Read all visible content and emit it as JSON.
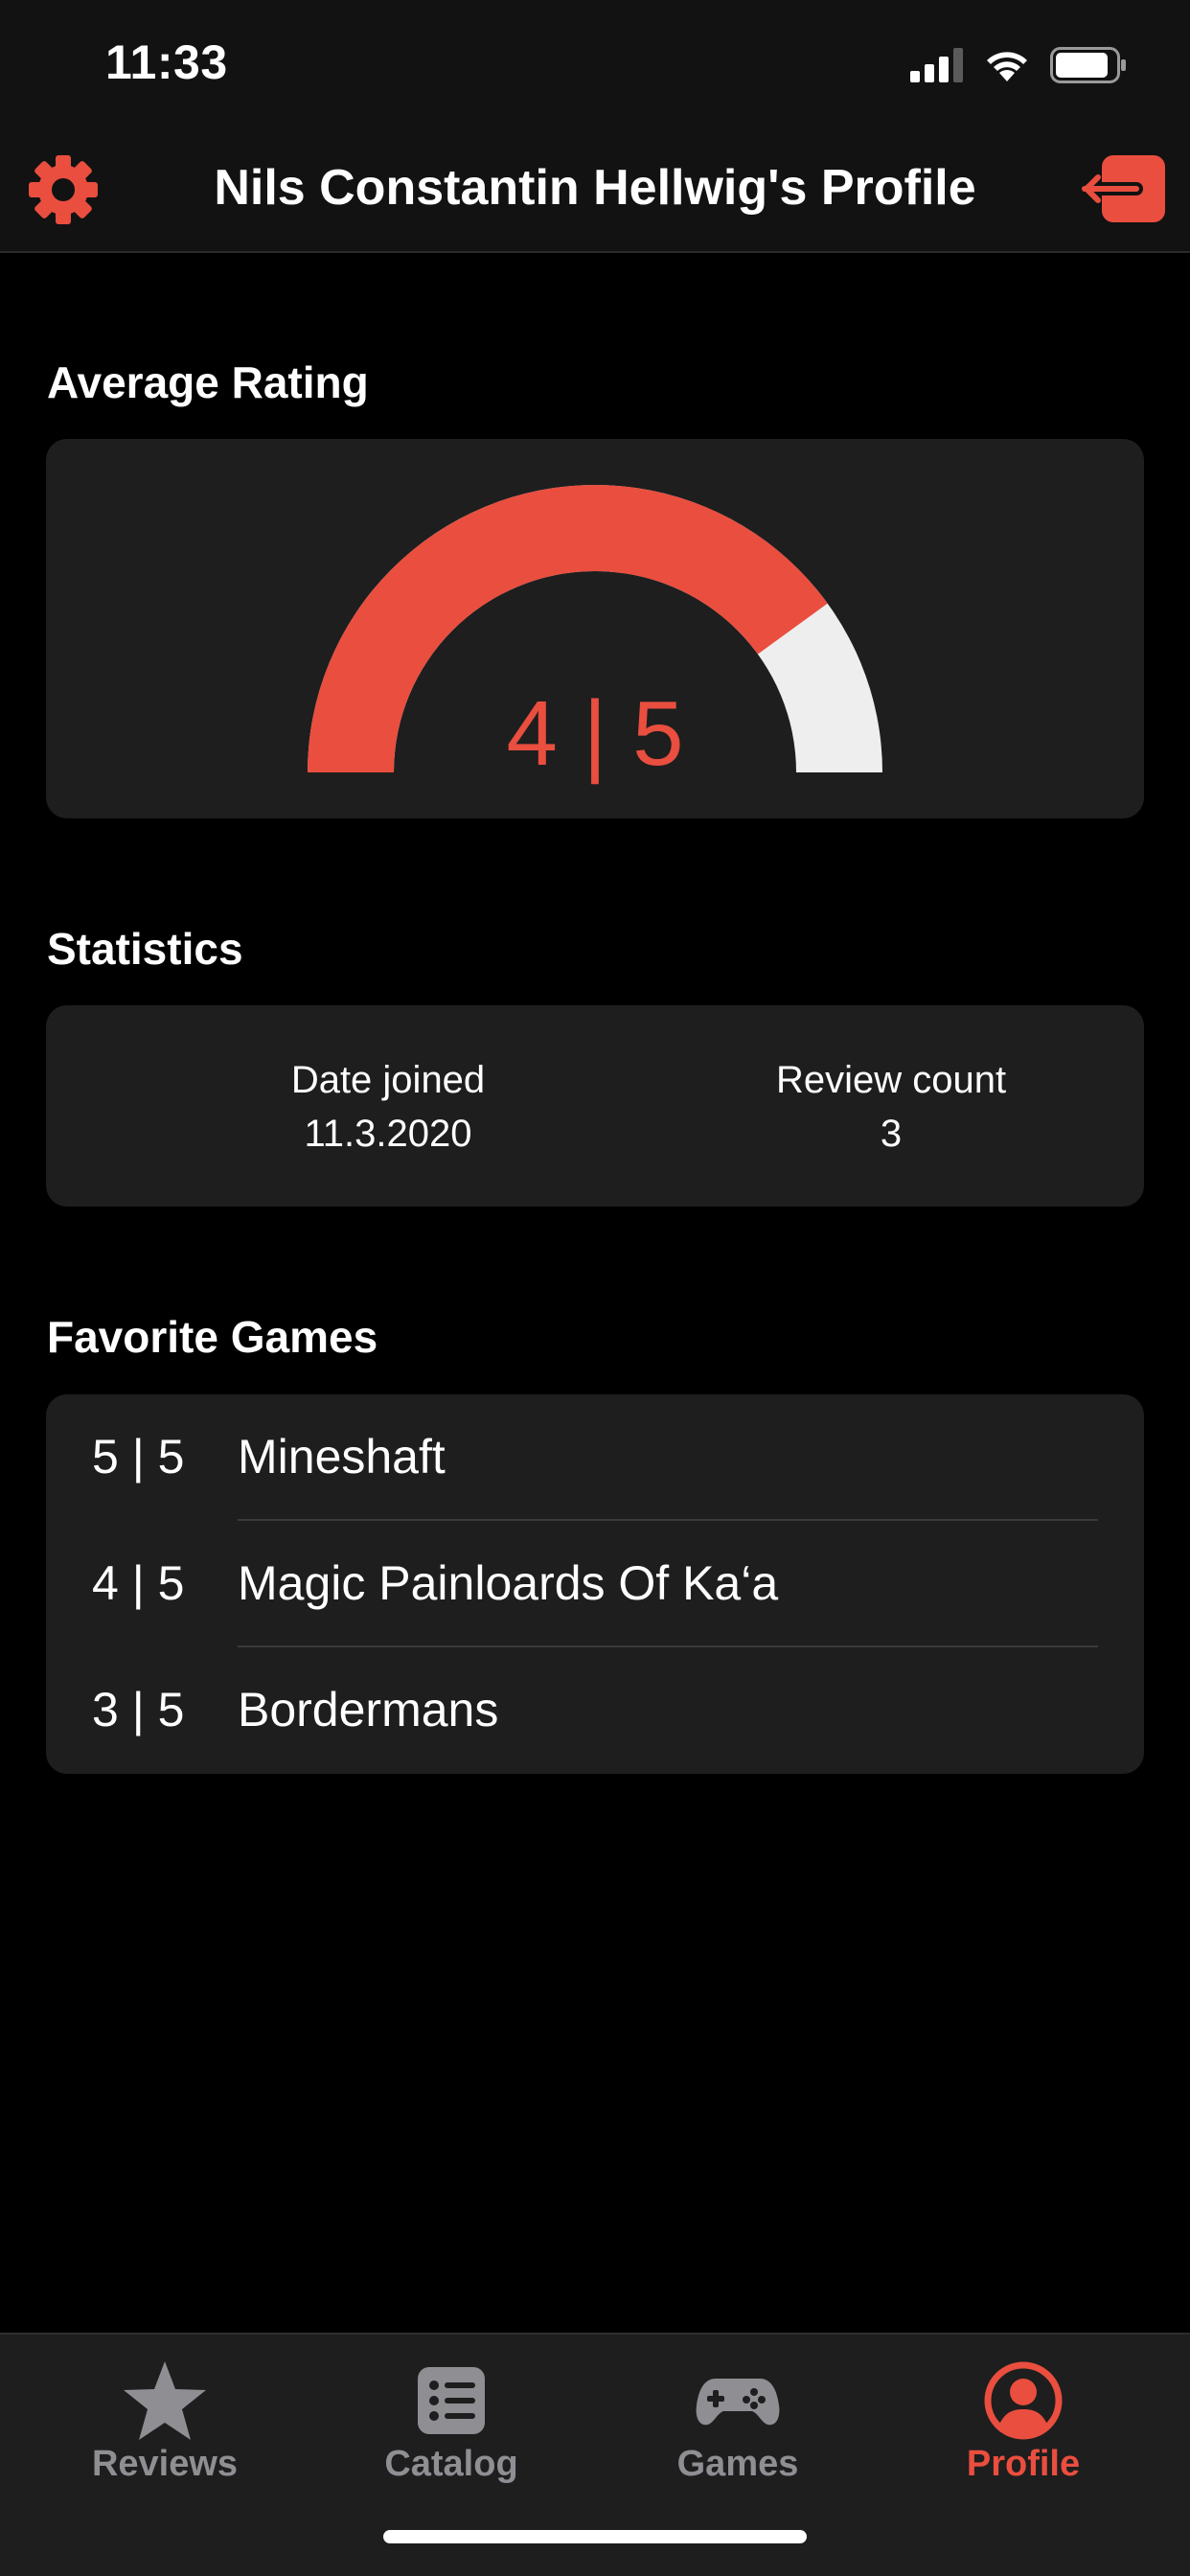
{
  "status_bar": {
    "time": "11:33"
  },
  "header": {
    "title": "Nils Constantin Hellwig's Profile"
  },
  "average_rating": {
    "section_title": "Average Rating",
    "value_label": "4 | 5",
    "rating": 4,
    "max": 5
  },
  "statistics": {
    "section_title": "Statistics",
    "date_joined_label": "Date joined",
    "date_joined_value": "11.3.2020",
    "review_count_label": "Review count",
    "review_count_value": "3"
  },
  "favorite_games": {
    "section_title": "Favorite Games",
    "items": [
      {
        "rating": "5 | 5",
        "name": "Mineshaft"
      },
      {
        "rating": "4 | 5",
        "name": "Magic Painloards Of Ka‘a"
      },
      {
        "rating": "3 | 5",
        "name": "Bordermans"
      }
    ]
  },
  "tab_bar": {
    "tabs": [
      {
        "label": "Reviews",
        "icon": "star-icon",
        "active": false
      },
      {
        "label": "Catalog",
        "icon": "list-icon",
        "active": false
      },
      {
        "label": "Games",
        "icon": "gamepad-icon",
        "active": false
      },
      {
        "label": "Profile",
        "icon": "profile-icon",
        "active": true
      }
    ]
  },
  "colors": {
    "accent": "#e94e3f",
    "background": "#000000",
    "card": "#1e1e1e",
    "header": "#121212",
    "gauge_empty": "#eeeeee",
    "inactive_tab": "#8e8e93"
  }
}
